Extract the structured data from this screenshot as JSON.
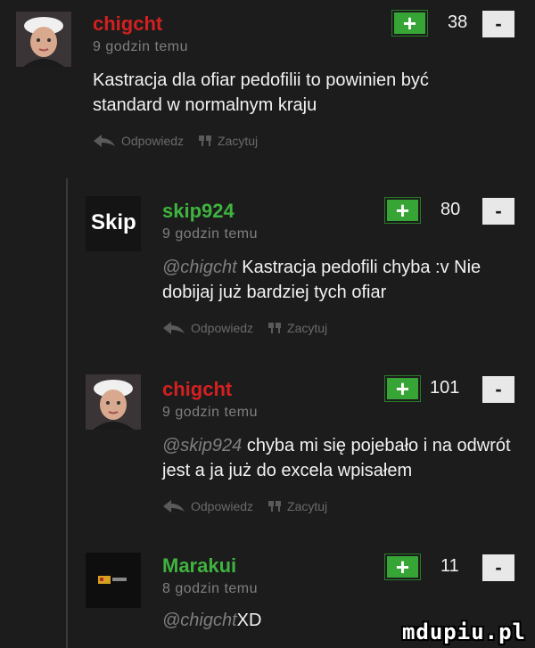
{
  "comments": [
    {
      "username": "chigcht",
      "time": "9 godzin temu",
      "mention": "",
      "text": "Kastracja dla ofiar pedofilii to powinien być standard w normalnym kraju",
      "votes": "38",
      "reply_label": "Odpowiedz",
      "quote_label": "Zacytuj",
      "avatar": "portrait-woman-white-cap"
    },
    {
      "username": "skip924",
      "time": "9 godzin temu",
      "mention": "@chigcht",
      "text": "Kastracja pedofili chyba :v Nie dobijaj już bardziej tych ofiar",
      "votes": "80",
      "reply_label": "Odpowiedz",
      "quote_label": "Zacytuj",
      "avatar_text": "Skip"
    },
    {
      "username": "chigcht",
      "time": "9 godzin temu",
      "mention": "@skip924",
      "text": "chyba mi się pojebało i na odwrót jest a ja już do excela wpisałem",
      "votes": "101",
      "reply_label": "Odpowiedz",
      "quote_label": "Zacytuj",
      "avatar": "portrait-woman-white-cap"
    },
    {
      "username": "Marakui",
      "time": "8 godzin temu",
      "mention": "@chigcht",
      "text": "XD",
      "votes": "11",
      "avatar": "dark-logo"
    }
  ],
  "vote_plus_symbol": "+",
  "vote_minus_symbol": "-",
  "watermark": "mdupiu.pl",
  "colors": {
    "username_red": "#d42020",
    "username_green": "#3fb33f",
    "plus_green": "#36a536",
    "background": "#1c1c1c"
  }
}
